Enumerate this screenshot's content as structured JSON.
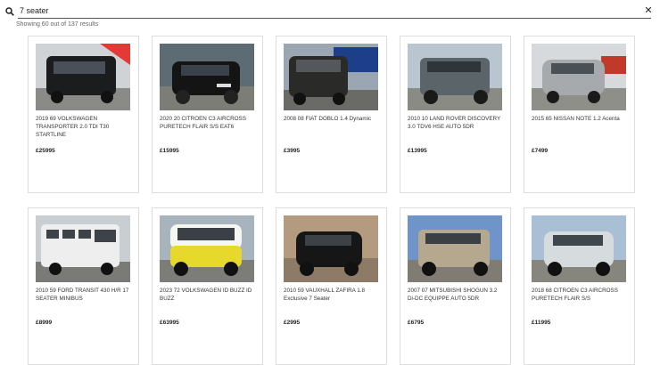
{
  "search": {
    "value": "7 seater",
    "placeholder": ""
  },
  "results": {
    "count_text": "Showing 60 out of 137 results"
  },
  "colors": {
    "accent_ribbon": "#e53935",
    "border": "#dddddd"
  },
  "icons": {
    "search": "search-icon",
    "clear": "close-icon"
  },
  "cars": [
    {
      "title": "2019 69 VOLKSWAGEN TRANSPORTER 2.0 TDI T30 STARTLINE",
      "price": "£25995"
    },
    {
      "title": "2020 20 CITROEN C3 AIRCROSS PURETECH FLAIR S/S EAT6",
      "price": "£15995"
    },
    {
      "title": "2008 08 FIAT DOBLO 1.4 Dynamic",
      "price": "£3995"
    },
    {
      "title": "2010 10 LAND ROVER DISCOVERY 3.0 TDV6 HSE AUTO 5DR",
      "price": "£13995"
    },
    {
      "title": "2015 65 NISSAN NOTE 1.2 Acenta",
      "price": "£7499"
    },
    {
      "title": "2010 59 FORD TRANSIT 430 H/R 17 SEATER MINIBUS",
      "price": "£8999"
    },
    {
      "title": "2023 72 VOLKSWAGEN ID BUZZ ID BUZZ",
      "price": "£63995"
    },
    {
      "title": "2010 59 VAUXHALL ZAFIRA 1.8 Exclusive 7 Seater",
      "price": "£2995"
    },
    {
      "title": "2007 07 MITSUBISHI SHOGUN 3.2 Di-DC EQUIPPE AUTO 5DR",
      "price": "£6795"
    },
    {
      "title": "2018 68 CITROEN C3 AIRCROSS PURETECH FLAIR S/S",
      "price": "£11995"
    }
  ]
}
